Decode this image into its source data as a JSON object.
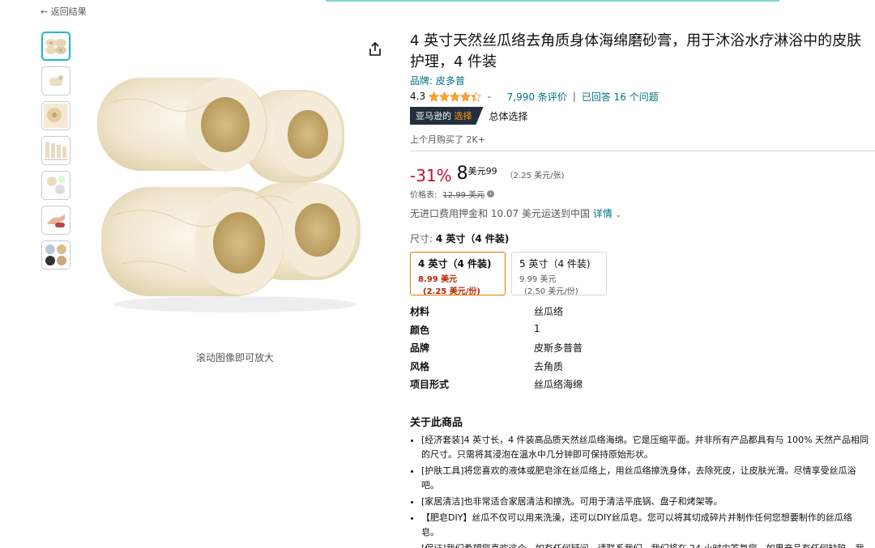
{
  "nav": {
    "back_label": "← 返回结果"
  },
  "gallery": {
    "zoom_hint": "滚动图像即可放大",
    "thumbnail_count": 7
  },
  "product": {
    "title": "4 英寸天然丝瓜络去角质身体海绵磨砂膏，用于沐浴水疗淋浴中的皮肤护理，4 件装",
    "brand_link": "品牌: 皮多普",
    "rating_score": "4.3",
    "rating_value": 4.3,
    "reviews_label": "7,990 条评价",
    "separator": "|",
    "answered_label": "已回答 16 个问题",
    "badge_prefix": "亚马逊的",
    "badge_highlight": "选择",
    "badge_text": "总体选择",
    "bought_label": "上个月购买了 2K+"
  },
  "pricing": {
    "discount": "-31%",
    "price_whole": "8",
    "price_unit": "美元99",
    "per_unit": "（2.25 美元/张)",
    "list_price_label": "价格表:",
    "list_price": "12.99 美元",
    "shipping_text": "无进口费用押金和 10.07 美元运送到中国",
    "shipping_details": "详情"
  },
  "size": {
    "label": "尺寸:",
    "selected_value": "4 英寸（4 件装)",
    "options": [
      {
        "name": "4 英寸（4 件装)",
        "price": "8.99 美元",
        "unit": "(2.25 美元/份)"
      },
      {
        "name": "5 英寸（4 件装)",
        "price": "9.99 美元",
        "unit": "(2.50 美元/份)"
      }
    ]
  },
  "specs": [
    {
      "key": "材料",
      "value": "丝瓜络"
    },
    {
      "key": "颜色",
      "value": "1"
    },
    {
      "key": "品牌",
      "value": "皮斯多普普"
    },
    {
      "key": "风格",
      "value": "去角质"
    },
    {
      "key": "项目形式",
      "value": "丝瓜络海绵"
    }
  ],
  "about": {
    "title": "关于此商品",
    "bullets": [
      "[经济套装]4 英寸长，4 件装高品质天然丝瓜络海绵。它是压缩平面。并非所有产品都具有与 100% 天然产品相同的尺寸。只需将其浸泡在温水中几分钟即可保持原始形状。",
      "[护肤工具]将您喜欢的液体或肥皂涂在丝瓜络上，用丝瓜络擦洗身体，去除死皮，让皮肤光滑。尽情享受丝瓜浴吧。",
      "[家居清洁]也非常适合家居清洁和擦洗。可用于清洁平底锅、盘子和烤架等。",
      "【肥皂DIY】丝瓜不仅可以用来洗澡，还可以DIY丝瓜皂。您可以将其切成碎片并制作任何您想要制作的丝瓜络皂。",
      "[保证]我们希望您喜欢这个。如有任何疑问，请联系我们，我们将在 24 小时内答复您。如果产品有任何缺陷，我们将为您提供新的替换品，或退还购买价格。"
    ]
  },
  "colors": {
    "link": "#007185",
    "discount": "#cc0c39",
    "selected_border": "#e77600",
    "star": "#ffa41c",
    "badge_bg": "#232f3e",
    "badge_accent": "#ff9900",
    "thumb_active": "#2fb5c8"
  }
}
